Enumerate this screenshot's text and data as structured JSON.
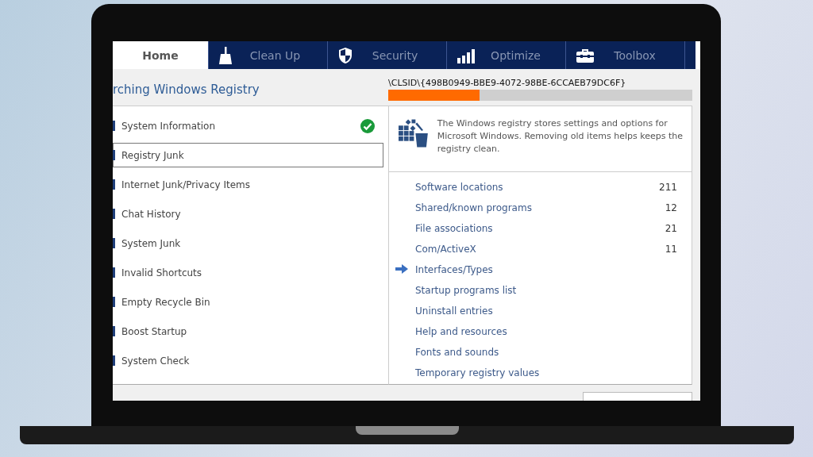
{
  "tabs": [
    {
      "label": "Home",
      "kind": "home",
      "selected": true
    },
    {
      "label": "Clean Up",
      "kind": "broom",
      "selected": false
    },
    {
      "label": "Security",
      "kind": "shield",
      "selected": false
    },
    {
      "label": "Optimize",
      "kind": "chart",
      "selected": false
    },
    {
      "label": "Toolbox",
      "kind": "toolbox",
      "selected": false
    }
  ],
  "scan": {
    "title": "rching Windows Registry",
    "path": "\\CLSID\\{498B0949-BBE9-4072-98BE-6CCAEB79DC6F}",
    "level": 0.3
  },
  "tasks": [
    {
      "label": "System Information",
      "done": true,
      "selected": false
    },
    {
      "label": "Registry Junk",
      "done": false,
      "selected": true
    },
    {
      "label": "Internet Junk/Privacy Items",
      "done": false,
      "selected": false
    },
    {
      "label": "Chat History",
      "done": false,
      "selected": false
    },
    {
      "label": "System Junk",
      "done": false,
      "selected": false
    },
    {
      "label": "Invalid Shortcuts",
      "done": false,
      "selected": false
    },
    {
      "label": "Empty Recycle Bin",
      "done": false,
      "selected": false
    },
    {
      "label": "Boost Startup",
      "done": false,
      "selected": false
    },
    {
      "label": "System Check",
      "done": false,
      "selected": false
    }
  ],
  "detail": {
    "description": "The Windows registry stores settings and options for Microsoft Windows. Removing old items helps keeps the registry clean.",
    "categories": [
      {
        "label": "Software locations",
        "count": "211",
        "current": false
      },
      {
        "label": "Shared/known programs",
        "count": "12",
        "current": false
      },
      {
        "label": "File associations",
        "count": "21",
        "current": false
      },
      {
        "label": "Com/ActiveX",
        "count": "11",
        "current": false
      },
      {
        "label": "Interfaces/Types",
        "current": true
      },
      {
        "label": "Startup programs list",
        "current": false
      },
      {
        "label": "Uninstall entries",
        "current": false
      },
      {
        "label": "Help and resources",
        "current": false
      },
      {
        "label": "Fonts and sounds",
        "current": false
      },
      {
        "label": "Temporary registry values",
        "current": false
      }
    ]
  }
}
